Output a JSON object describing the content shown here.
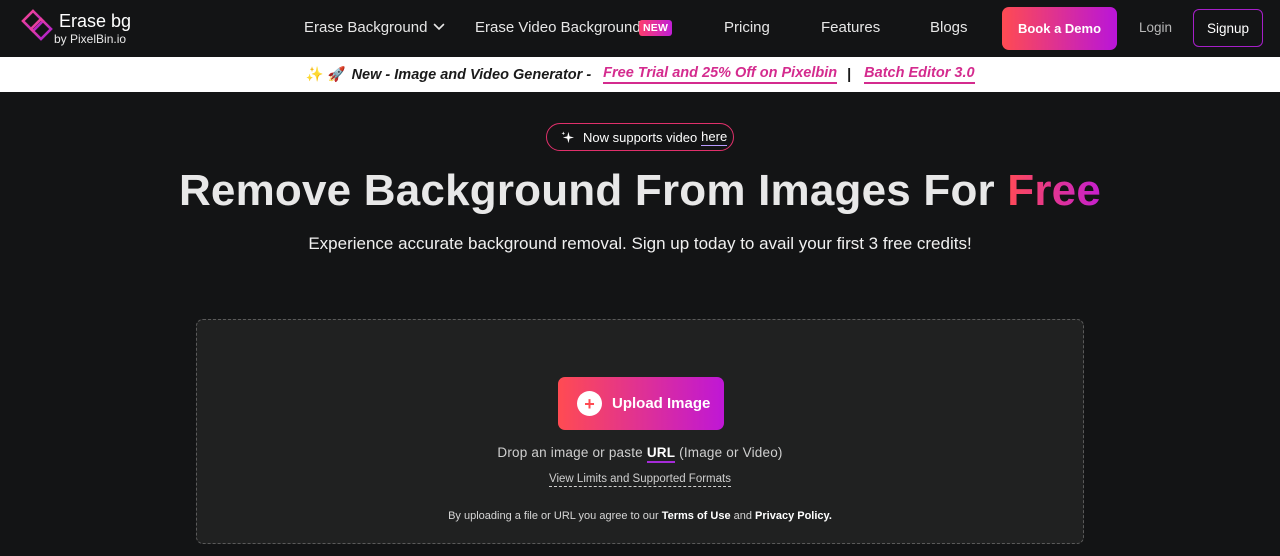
{
  "brand": {
    "title": "Erase bg",
    "subtitle": "by PixelBin.io"
  },
  "nav": {
    "erase_background": "Erase Background",
    "erase_video_background": "Erase Video Background",
    "new_badge": "NEW",
    "pricing": "Pricing",
    "features": "Features",
    "blogs": "Blogs",
    "book_demo": "Book a Demo",
    "login": "Login",
    "signup": "Signup"
  },
  "promo": {
    "emoji": "✨ 🚀",
    "text": "New - Image and Video Generator -",
    "link1": "Free Trial and 25% Off on Pixelbin",
    "separator": "|",
    "link2": "Batch Editor 3.0"
  },
  "hero": {
    "pill_text": "Now supports video",
    "pill_link": "here",
    "title_main": "Remove Background From Images For ",
    "title_highlight": "Free",
    "subtitle": "Experience accurate background removal. Sign up today to avail your first 3 free credits!"
  },
  "upload": {
    "button_label": "Upload Image",
    "drop_prefix": "Drop an image or paste ",
    "drop_url": "URL",
    "drop_suffix": " (Image or Video)",
    "limits": "View Limits and Supported Formats",
    "terms_prefix": "By uploading a file or URL you agree to our ",
    "terms_link": "Terms of Use",
    "terms_and": " and ",
    "privacy_link": "Privacy Policy."
  },
  "colors": {
    "accent_start": "#ff4b52",
    "accent_end": "#b915d9",
    "promo_link": "#d42b8e",
    "background": "#131415"
  }
}
